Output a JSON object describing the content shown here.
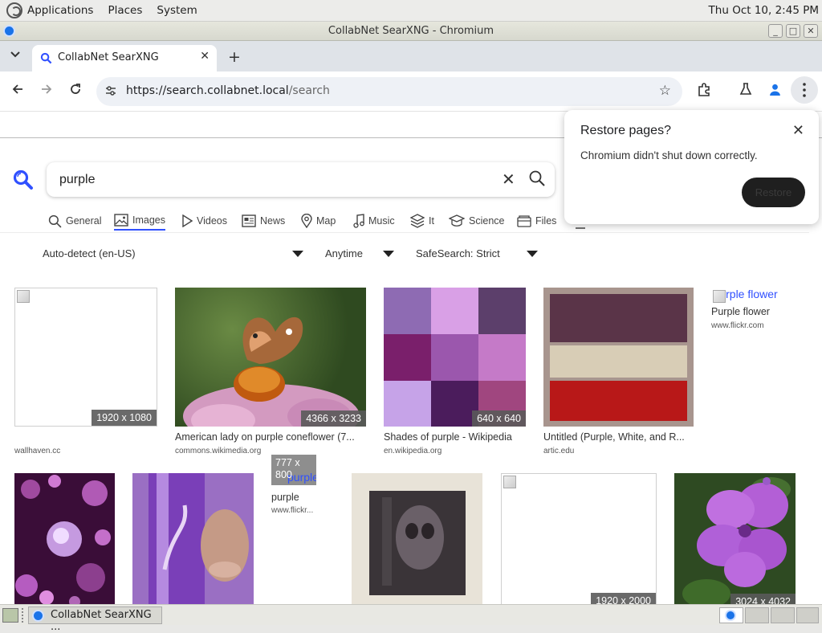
{
  "panel": {
    "menu": [
      "Applications",
      "Places",
      "System"
    ],
    "clock": "Thu Oct 10,  2:45 PM"
  },
  "window": {
    "title": "CollabNet SearXNG - Chromium"
  },
  "browser": {
    "tab_title": "CollabNet SearXNG",
    "url_host": "https://search.collabnet.local",
    "url_path": "/search"
  },
  "search": {
    "query": "purple",
    "categories": [
      {
        "label": "General",
        "icon": "search-icon"
      },
      {
        "label": "Images",
        "icon": "image-icon"
      },
      {
        "label": "Videos",
        "icon": "play-icon"
      },
      {
        "label": "News",
        "icon": "newspaper-icon"
      },
      {
        "label": "Map",
        "icon": "map-pin-icon"
      },
      {
        "label": "Music",
        "icon": "music-note-icon"
      },
      {
        "label": "It",
        "icon": "layers-icon"
      },
      {
        "label": "Science",
        "icon": "graduation-cap-icon"
      },
      {
        "label": "Files",
        "icon": "files-icon"
      }
    ],
    "active_category": "Images",
    "filters": {
      "language": "Auto-detect (en-US)",
      "time": "Anytime",
      "safesearch": "SafeSearch: Strict"
    }
  },
  "results": [
    {
      "title": "",
      "source": "wallhaven.cc",
      "dims": "1920 x 1080"
    },
    {
      "title": "American lady on purple coneflower (7...",
      "source": "commons.wikimedia.org",
      "dims": "4366 x 3233"
    },
    {
      "title": "Shades of purple - Wikipedia",
      "source": "en.wikipedia.org",
      "dims": "640 x 640"
    },
    {
      "title": "Untitled (Purple, White, and R...",
      "source": "artic.edu",
      "dims": ""
    },
    {
      "title": "Purple flower",
      "alt": "Purple flower",
      "source": "www.flickr.com",
      "dims": ""
    },
    {
      "title": "",
      "source": "",
      "dims": ""
    },
    {
      "title": "",
      "source": "",
      "dims": ""
    },
    {
      "title": "purple",
      "alt": "purple",
      "source": "www.flickr...",
      "dims": "777 x 800"
    },
    {
      "title": "",
      "source": "",
      "dims": ""
    },
    {
      "title": "",
      "source": "",
      "dims": "1920 x 2000"
    },
    {
      "title": "",
      "source": "",
      "dims": "3024 x 4032"
    }
  ],
  "restore_popup": {
    "title": "Restore pages?",
    "message": "Chromium didn't shut down correctly.",
    "button": "Restore"
  },
  "taskbar": {
    "item": "CollabNet SearXNG ..."
  },
  "colors": {
    "accent": "#3050ff",
    "tab_strip": "#dfe3e8",
    "omnibox": "#eef1f6"
  }
}
